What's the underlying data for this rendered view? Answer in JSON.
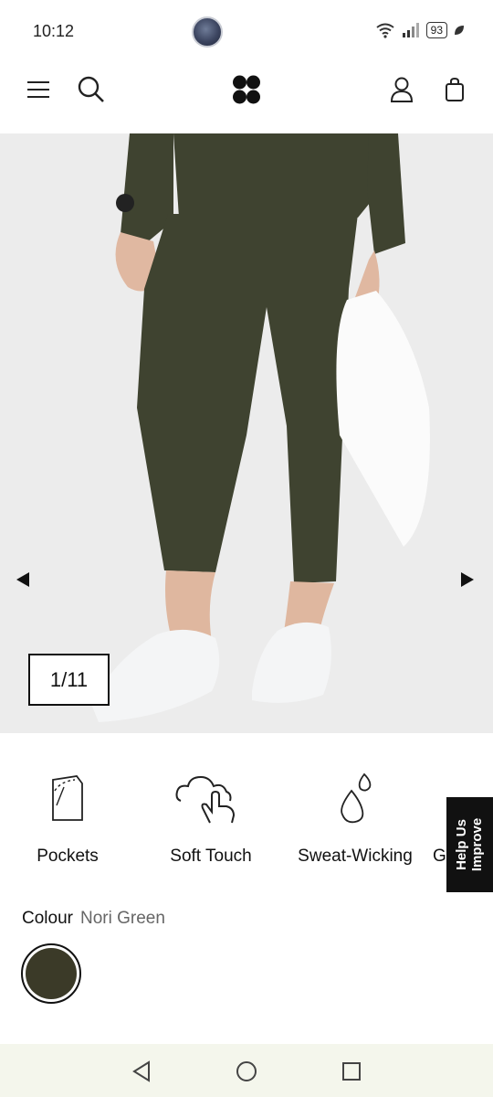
{
  "status_bar": {
    "time": "10:12",
    "battery": "93"
  },
  "header": {
    "menu_icon": "hamburger-menu-icon",
    "search_icon": "search-icon",
    "logo": "brand-logo-icon",
    "account_icon": "user-icon",
    "bag_icon": "shopping-bag-icon"
  },
  "gallery": {
    "counter": "1/11",
    "prev_icon": "arrow-left-icon",
    "next_icon": "arrow-right-icon"
  },
  "features": [
    {
      "label": "Pockets",
      "icon": "pockets-icon"
    },
    {
      "label": "Soft Touch",
      "icon": "soft-touch-icon"
    },
    {
      "label": "Sweat-Wicking",
      "icon": "sweat-wicking-icon"
    },
    {
      "label": "G",
      "icon": "partial-feature-icon"
    }
  ],
  "help_tab": {
    "line1": "Help Us",
    "line2": "Improve"
  },
  "colour": {
    "label": "Colour",
    "value": "Nori Green",
    "swatch_color": "#3b3a28"
  },
  "colors": {
    "product": "#3f4330",
    "background": "#ececec",
    "nav_bar": "#f4f6ec"
  }
}
